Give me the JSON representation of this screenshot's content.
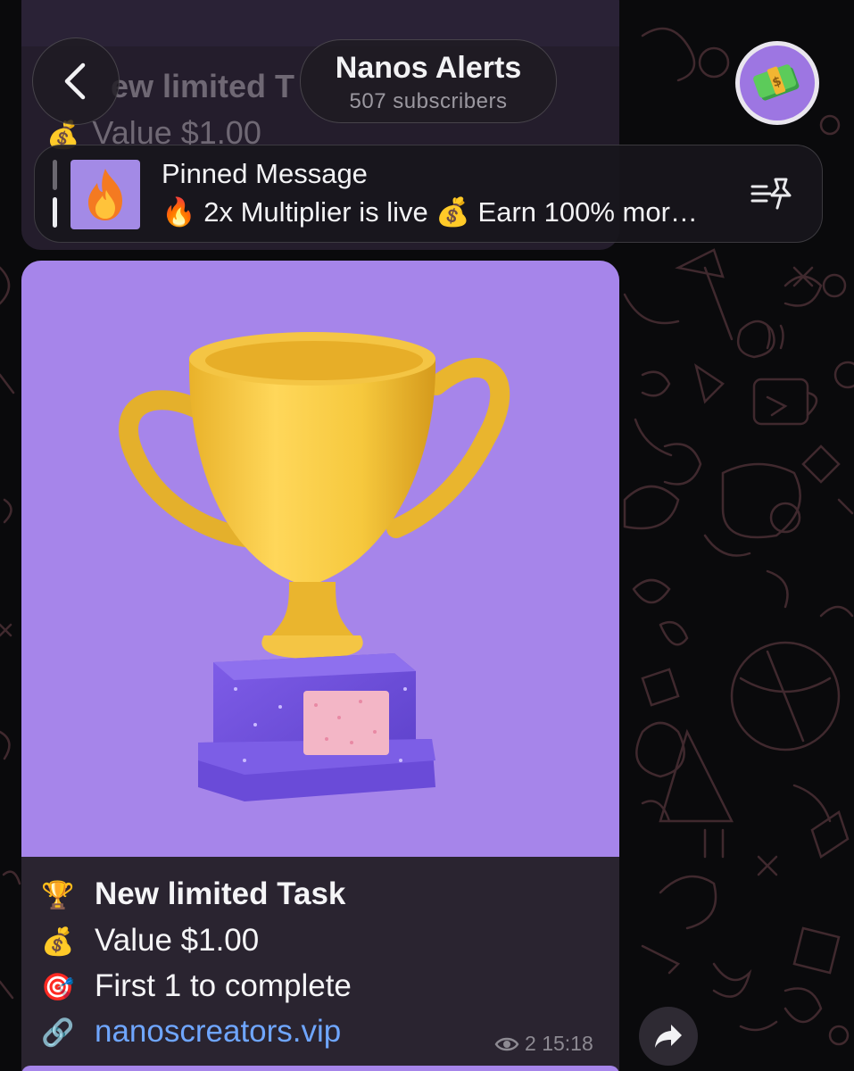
{
  "header": {
    "channel_name": "Nanos Alerts",
    "subscribers": "507 subscribers"
  },
  "previous_message": {
    "title_fragment": "ew limited T",
    "value_line": "Value $1.00"
  },
  "pinned": {
    "title": "Pinned Message",
    "text": "🔥 2x Multiplier is live 💰 Earn 100% mor…",
    "thumb_emoji": "🔥"
  },
  "message": {
    "lines": [
      {
        "emoji": "🏆",
        "text": "New limited Task"
      },
      {
        "emoji": "💰",
        "text": "Value $1.00"
      },
      {
        "emoji": "🎯",
        "text": "First 1 to complete"
      },
      {
        "emoji": "🔗",
        "text": "nanoscreators.vip"
      }
    ],
    "views": "2",
    "time": "15:18"
  },
  "colors": {
    "accent_purple": "#a685ea",
    "link": "#6fa6ff",
    "bubble": "#2a2430"
  },
  "icons": {
    "back": "chevron-left-icon",
    "pin_list": "pin-list-icon",
    "views": "eye-icon",
    "share": "share-arrow-icon"
  }
}
